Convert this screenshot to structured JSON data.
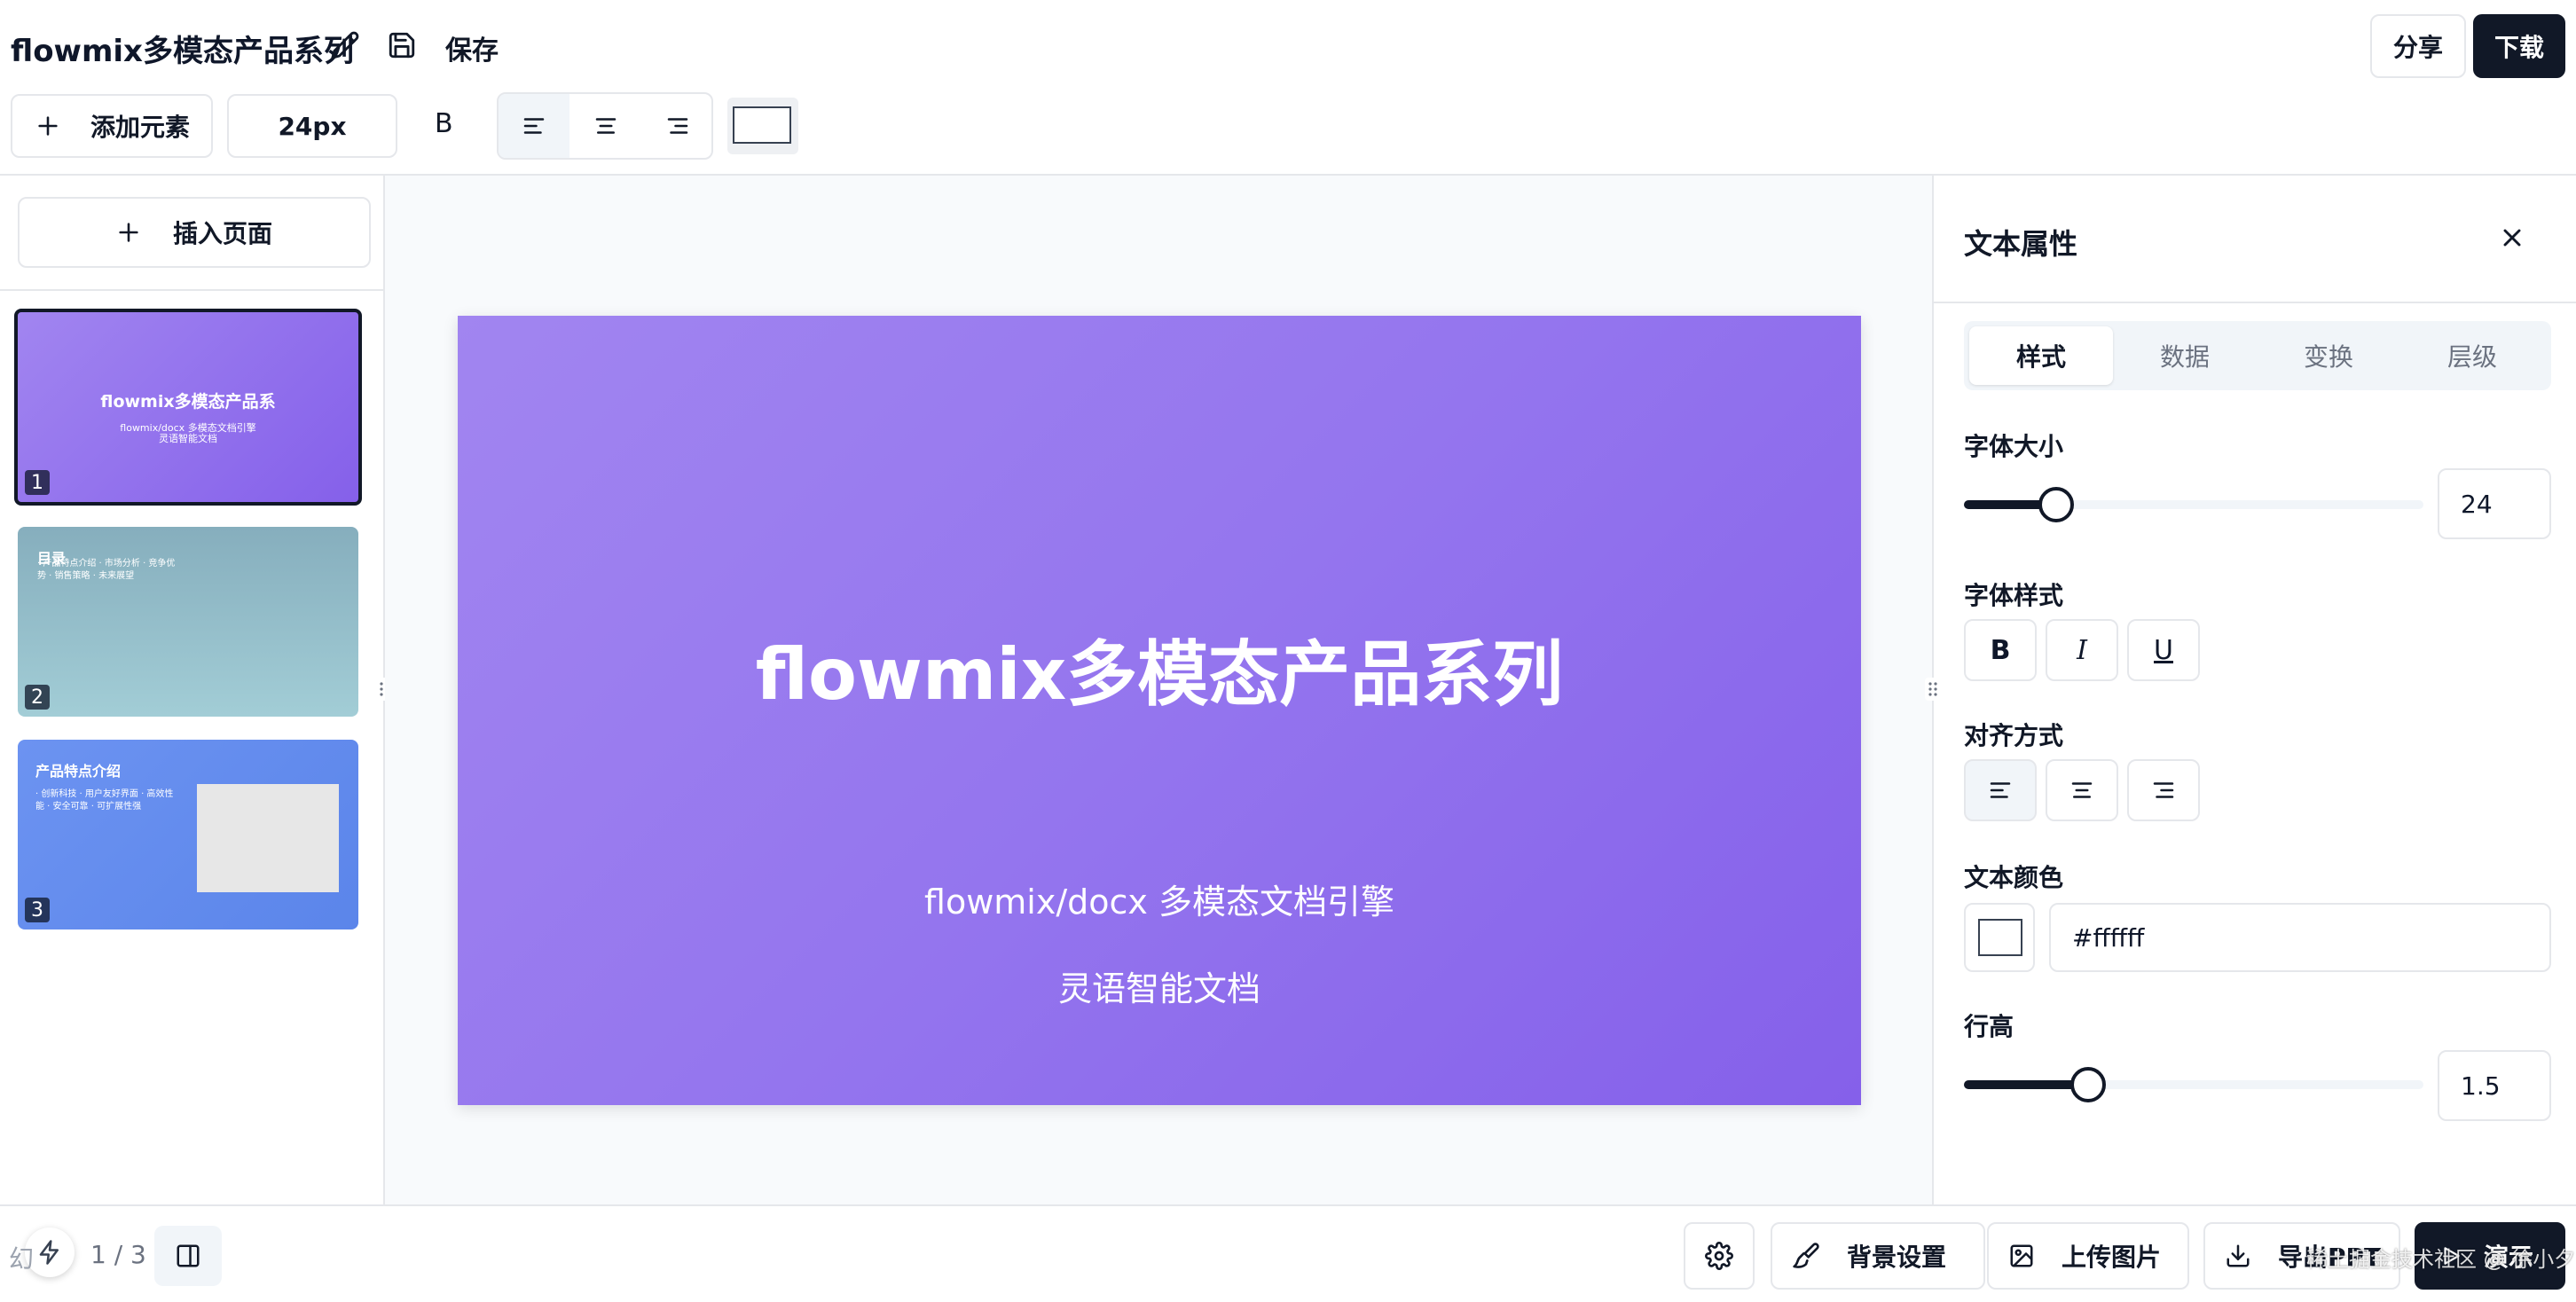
{
  "header": {
    "title": "flowmix多模态产品系列",
    "save_label": "保存",
    "share_label": "分享",
    "download_label": "下载"
  },
  "toolbar": {
    "add_element_label": "添加元素",
    "font_size_value": "24px",
    "bold_label": "B",
    "text_color": "#ffffff"
  },
  "sidebar": {
    "insert_page_label": "插入页面",
    "slides": [
      {
        "number": "1",
        "title": "flowmix多模态产品系",
        "subtitle_a": "flowmix/docx 多模态文档引擎",
        "subtitle_b": "灵语智能文档",
        "active": true
      },
      {
        "number": "2",
        "title": "目录",
        "line_a": "· 产品特点介绍 · 市场分析 · 竞争优",
        "line_b": "势 · 销售策略 · 未来展望"
      },
      {
        "number": "3",
        "title": "产品特点介绍",
        "line_a": "· 创新科技 · 用户友好界面 · 高效性",
        "line_b": "能 · 安全可靠 · 可扩展性强"
      }
    ]
  },
  "canvas": {
    "title": "flowmix多模态产品系列",
    "subtitle": "flowmix/docx 多模态文档引擎",
    "subtitle2": "灵语智能文档",
    "gradient_start": "#a185f0",
    "gradient_end": "#8560ea"
  },
  "panel": {
    "title": "文本属性",
    "tabs": [
      "样式",
      "数据",
      "变换",
      "层级"
    ],
    "font_size_label": "字体大小",
    "font_size_value": "24",
    "font_size_fraction": 0.2,
    "font_style_label": "字体样式",
    "bold": "B",
    "italic": "I",
    "underline": "U",
    "align_label": "对齐方式",
    "color_label": "文本颜色",
    "color_value": "#ffffff",
    "line_height_label": "行高",
    "line_height_value": "1.5",
    "line_height_fraction": 0.27
  },
  "footer": {
    "page_indicator": "1 / 3",
    "page_prefix": "幻",
    "bg_settings_label": "背景设置",
    "upload_image_label": "上传图片",
    "export_label": "导出PPT",
    "present_label": "演示",
    "watermark": "稀土掘金技术社区 @ 徐小夕"
  },
  "colors": {
    "accent": "#111827",
    "border": "#e5e7eb",
    "canvas_bg": "#f8fafc",
    "slide2_bg": "#8fb8c5",
    "slide3_bg": "#6a8ff0"
  }
}
